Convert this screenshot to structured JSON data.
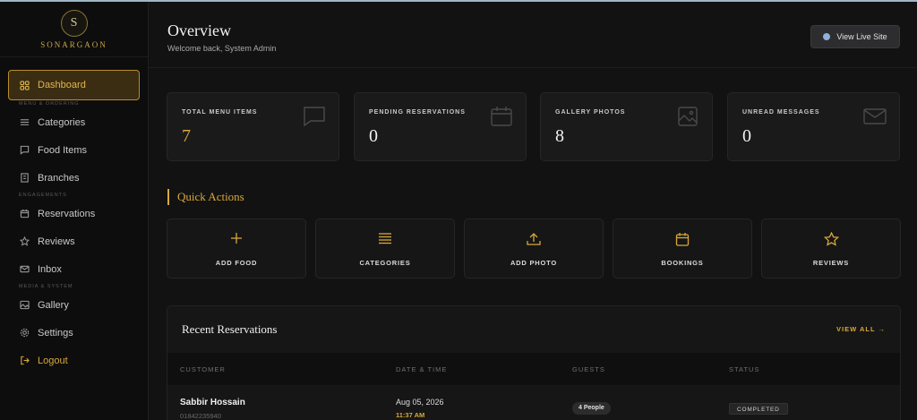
{
  "brand": {
    "initial": "S",
    "name": "SONARGAON"
  },
  "sidebar": {
    "items": [
      {
        "label": "Dashboard",
        "icon": "grid-icon",
        "active": true
      },
      {
        "section": "MENU & ORDERING"
      },
      {
        "label": "Categories",
        "icon": "list-icon"
      },
      {
        "label": "Food Items",
        "icon": "chat-icon"
      },
      {
        "label": "Branches",
        "icon": "building-icon"
      },
      {
        "section": "ENGAGEMENTS"
      },
      {
        "label": "Reservations",
        "icon": "calendar-icon"
      },
      {
        "label": "Reviews",
        "icon": "star-icon"
      },
      {
        "label": "Inbox",
        "icon": "mail-icon"
      },
      {
        "section": "MEDIA & SYSTEM"
      },
      {
        "label": "Gallery",
        "icon": "image-icon"
      },
      {
        "label": "Settings",
        "icon": "gear-icon"
      },
      {
        "label": "Logout",
        "icon": "logout-icon"
      }
    ]
  },
  "header": {
    "title": "Overview",
    "subtitle": "Welcome back, System Admin",
    "live_button": "View Live Site"
  },
  "stats": [
    {
      "label": "TOTAL MENU ITEMS",
      "value": "7",
      "icon": "chat-icon"
    },
    {
      "label": "PENDING RESERVATIONS",
      "value": "0",
      "icon": "calendar-icon"
    },
    {
      "label": "GALLERY PHOTOS",
      "value": "8",
      "icon": "image-icon"
    },
    {
      "label": "UNREAD MESSAGES",
      "value": "0",
      "icon": "mail-icon"
    }
  ],
  "quick_actions": {
    "title": "Quick Actions",
    "items": [
      {
        "label": "ADD FOOD",
        "icon": "plus-icon"
      },
      {
        "label": "CATEGORIES",
        "icon": "list-icon"
      },
      {
        "label": "ADD PHOTO",
        "icon": "upload-icon"
      },
      {
        "label": "BOOKINGS",
        "icon": "calendar-icon"
      },
      {
        "label": "REVIEWS",
        "icon": "star-icon"
      }
    ]
  },
  "recent": {
    "title": "Recent Reservations",
    "view_all": "VIEW ALL →",
    "columns": [
      "CUSTOMER",
      "DATE & TIME",
      "GUESTS",
      "STATUS"
    ],
    "rows": [
      {
        "name": "Sabbir Hossain",
        "phone": "01842235940",
        "date": "Aug 05, 2026",
        "time": "11:37 AM",
        "guests": "4 People",
        "status": "COMPLETED"
      }
    ]
  },
  "colors": {
    "accent": "#d9a83a",
    "background": "#121212",
    "sidebar": "#0d0d0d"
  }
}
